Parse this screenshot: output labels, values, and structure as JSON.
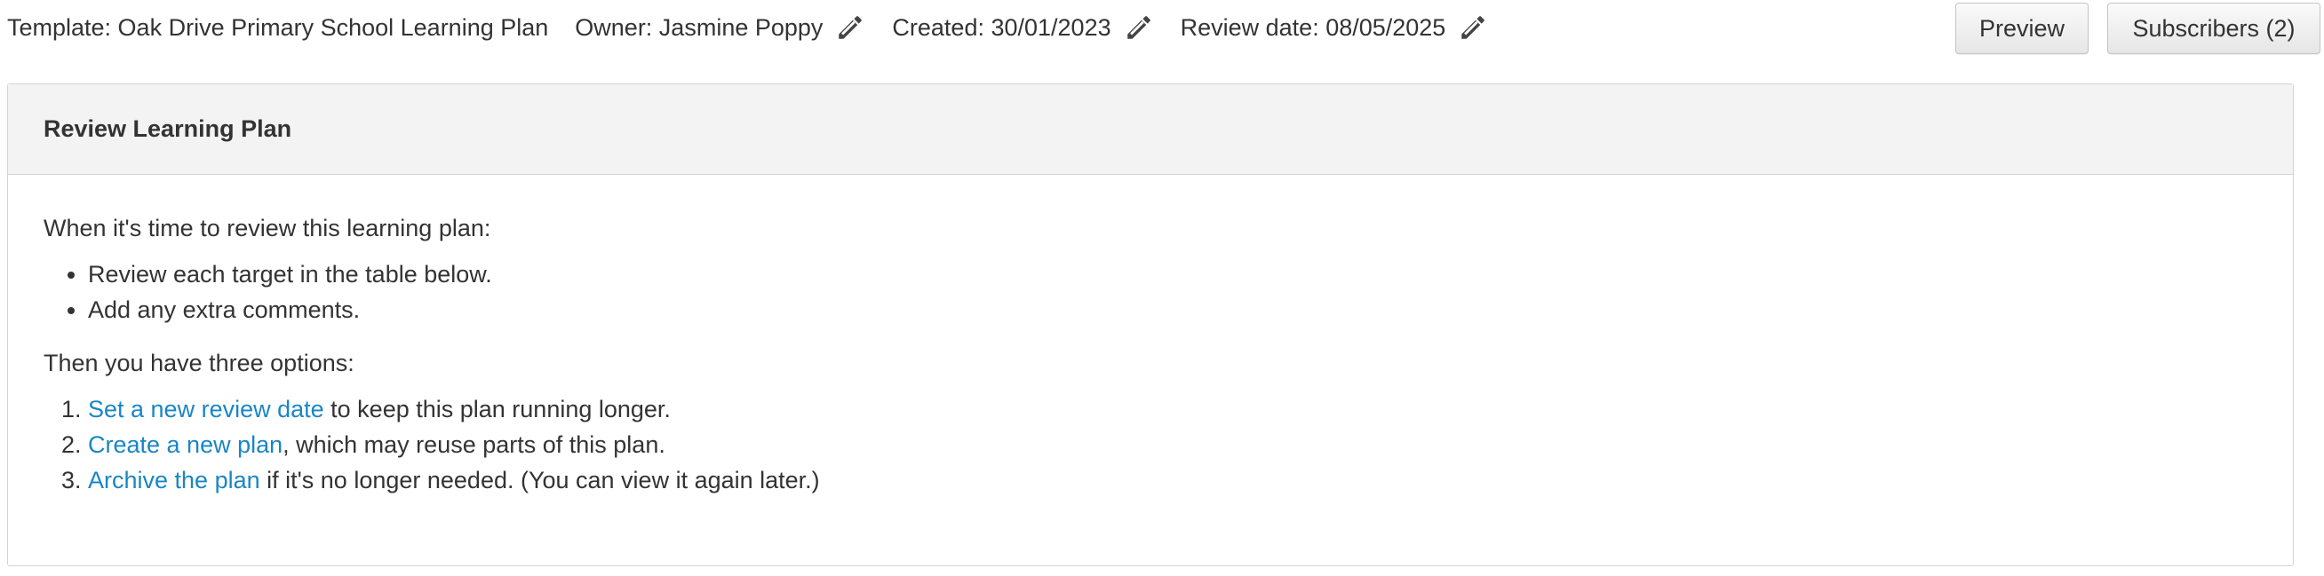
{
  "header": {
    "template_label": "Template: Oak Drive Primary School Learning Plan",
    "owner_label": "Owner: Jasmine Poppy",
    "created_label": "Created: 30/01/2023",
    "review_label": "Review date: 08/05/2025",
    "preview_button": "Preview",
    "subscribers_button": "Subscribers (2)",
    "icons": [
      "pencil-icon",
      "pencil-icon",
      "pencil-icon"
    ]
  },
  "panel": {
    "title": "Review Learning Plan",
    "intro": "When it's time to review this learning plan:",
    "bullets": [
      "Review each target in the table below.",
      "Add any extra comments."
    ],
    "options_intro": "Then you have three options:",
    "options": [
      {
        "link": "Set a new review date",
        "rest": " to keep this plan running longer."
      },
      {
        "link": "Create a new plan",
        "rest": ", which may reuse parts of this plan."
      },
      {
        "link": "Archive the plan",
        "rest": " if it's no longer needed. (You can view it again later.)"
      }
    ]
  },
  "colors": {
    "link": "#1a86c5",
    "text": "#333333",
    "panel_header_bg": "#f3f3f4",
    "border": "#d4d4d4"
  }
}
